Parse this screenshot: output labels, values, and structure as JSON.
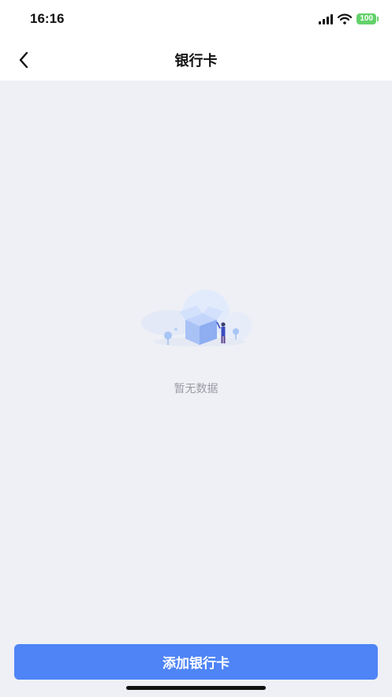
{
  "status_bar": {
    "time": "16:16",
    "battery_level": "100",
    "icons": [
      "signal-icon",
      "wifi-icon",
      "battery-icon"
    ],
    "battery_color": "#64d26b"
  },
  "nav": {
    "back_icon": "chevron-left-icon",
    "title": "银行卡"
  },
  "content": {
    "empty_illustration_icon": "empty-box-icon",
    "empty_text": "暂无数据"
  },
  "footer": {
    "add_button_label": "添加银行卡",
    "add_button_color": "#4f84f6"
  },
  "colors": {
    "background": "#eef0f5",
    "bar_background": "#ffffff",
    "muted_text": "#9a9ca3"
  }
}
